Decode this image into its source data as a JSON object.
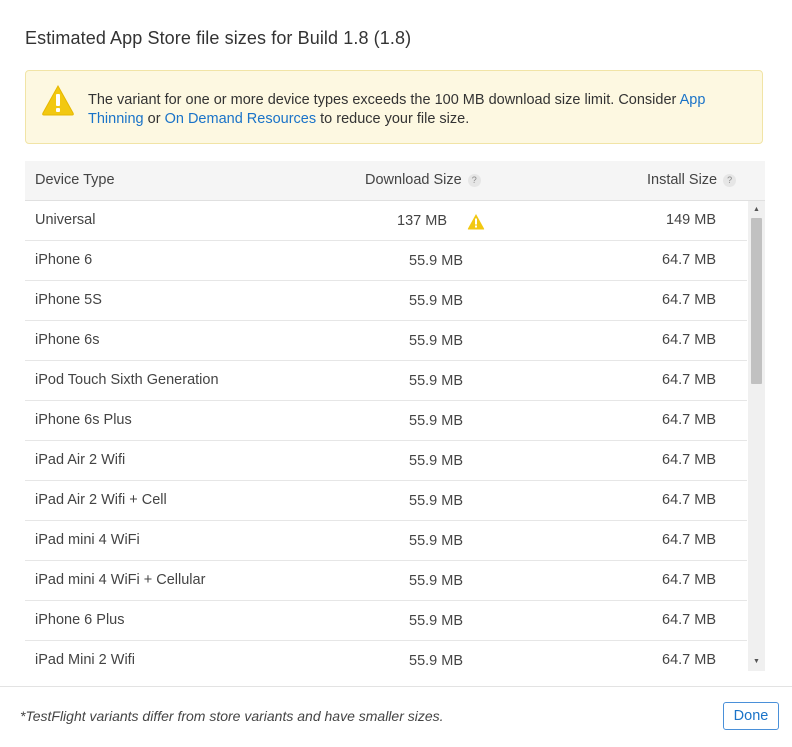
{
  "dialog": {
    "title": "Estimated App Store file sizes for Build 1.8 (1.8)",
    "alert": {
      "text_before": "The variant for one or more device types exceeds the 100 MB download size limit. Consider ",
      "link_app_thinning": "App Thinning",
      "text_middle": " or ",
      "link_on_demand": "On Demand Resources",
      "text_after": " to reduce your file size.",
      "icon": "warning-icon"
    },
    "table": {
      "headers": {
        "device_type": "Device Type",
        "download_size": "Download Size",
        "install_size": "Install Size",
        "help_glyph": "?"
      },
      "rows": [
        {
          "device": "Universal",
          "download": "137 MB",
          "install": "149 MB",
          "warning": true
        },
        {
          "device": "iPhone 6",
          "download": "55.9 MB",
          "install": "64.7 MB"
        },
        {
          "device": "iPhone 5S",
          "download": "55.9 MB",
          "install": "64.7 MB"
        },
        {
          "device": "iPhone 6s",
          "download": "55.9 MB",
          "install": "64.7 MB"
        },
        {
          "device": "iPod Touch Sixth Generation",
          "download": "55.9 MB",
          "install": "64.7 MB"
        },
        {
          "device": "iPhone 6s Plus",
          "download": "55.9 MB",
          "install": "64.7 MB"
        },
        {
          "device": "iPad Air 2 Wifi",
          "download": "55.9 MB",
          "install": "64.7 MB"
        },
        {
          "device": "iPad Air 2 Wifi + Cell",
          "download": "55.9 MB",
          "install": "64.7 MB"
        },
        {
          "device": "iPad mini 4 WiFi",
          "download": "55.9 MB",
          "install": "64.7 MB"
        },
        {
          "device": "iPad mini 4 WiFi + Cellular",
          "download": "55.9 MB",
          "install": "64.7 MB"
        },
        {
          "device": "iPhone 6 Plus",
          "download": "55.9 MB",
          "install": "64.7 MB"
        },
        {
          "device": "iPad Mini 2 Wifi",
          "download": "55.9 MB",
          "install": "64.7 MB"
        }
      ]
    },
    "footer": {
      "note": "*TestFlight variants differ from store variants and have smaller sizes.",
      "done_label": "Done"
    },
    "colors": {
      "accent": "#1a73c8",
      "warning": "#f2c811",
      "alert_bg": "#fdf8e1"
    }
  }
}
